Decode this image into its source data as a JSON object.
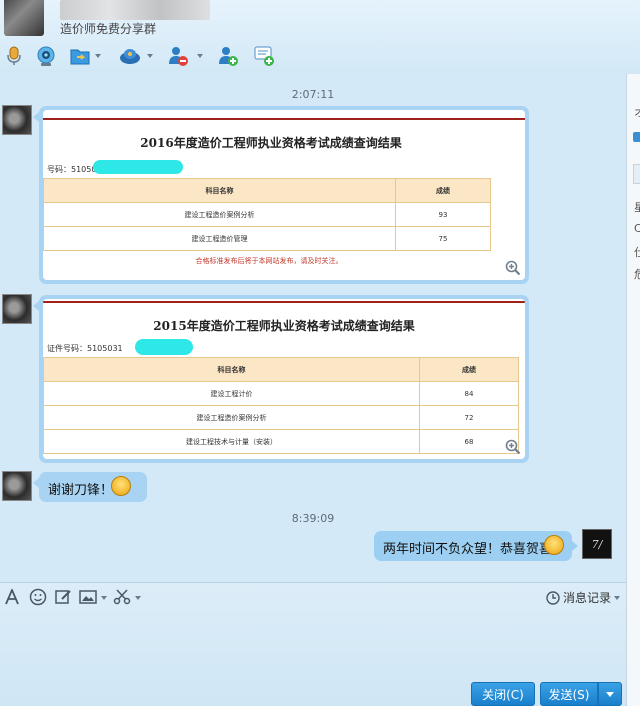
{
  "header": {
    "group_title": "造价师免费分享群"
  },
  "chat": {
    "time1": "2:07:11",
    "time2": "8:39:09",
    "card1": {
      "title": "2016年度造价工程师执业资格考试成绩查询结果",
      "id_label": "号码：51050",
      "col_subject": "科目名称",
      "col_score": "成绩",
      "rows": [
        {
          "subject": "建设工程造价案例分析",
          "score": "93"
        },
        {
          "subject": "建设工程造价管理",
          "score": "75"
        }
      ],
      "note": "合格标准发布后将于本网站发布，请及时关注。"
    },
    "card2": {
      "title": "2015年度造价工程师执业资格考试成绩查询结果",
      "id_label": "证件号码：5105031",
      "col_subject": "科目名称",
      "col_score": "成绩",
      "rows": [
        {
          "subject": "建设工程计价",
          "score": "84"
        },
        {
          "subject": "建设工程造价案例分析",
          "score": "72"
        },
        {
          "subject": "建设工程技术与计量（安装）",
          "score": "68"
        }
      ]
    },
    "msg_in": "谢谢刀锋！",
    "msg_out": "两年时间不负众望！恭喜贺喜"
  },
  "input": {
    "history_label": "消息记录"
  },
  "buttons": {
    "close": "关闭(C)",
    "send": "发送(S)"
  },
  "right_panel": {
    "t1": "オ",
    "t2": "星",
    "t3": "C",
    "t4": "仕",
    "t5": "危"
  }
}
